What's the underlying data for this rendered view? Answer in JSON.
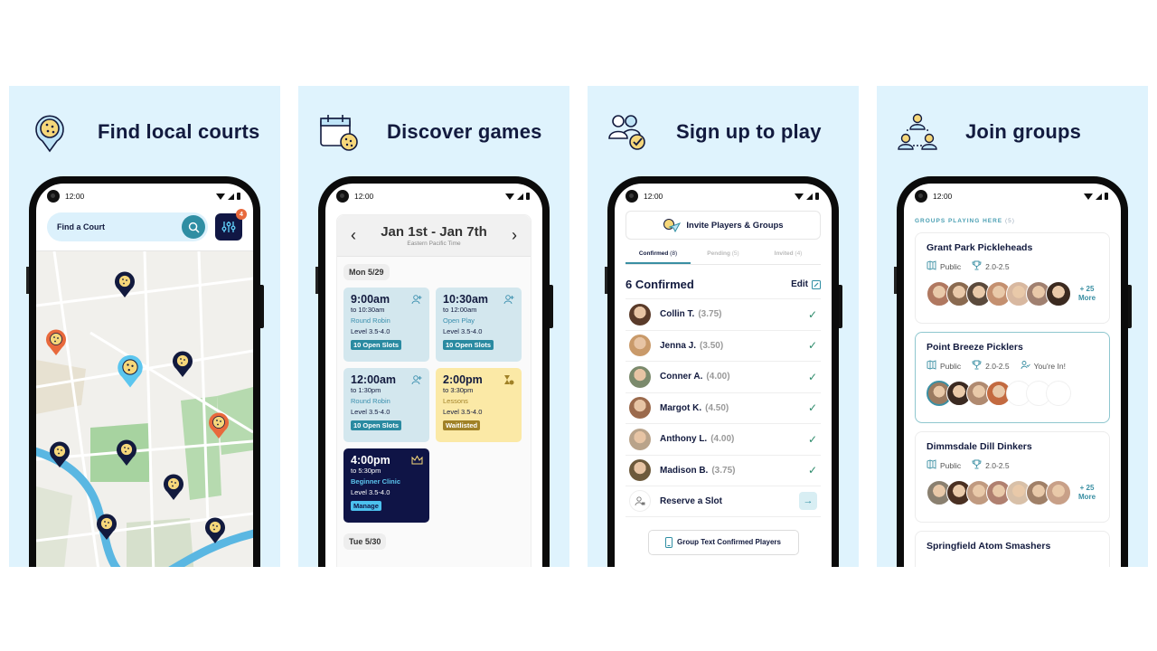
{
  "status_time": "12:00",
  "panels": [
    {
      "headline": "Find local courts",
      "icon": "court-pin-icon",
      "search": {
        "placeholder": "Find a Court",
        "filter_badge": "4"
      },
      "map": {
        "pins": [
          {
            "type": "navy"
          },
          {
            "type": "orange"
          },
          {
            "type": "selected"
          },
          {
            "type": "navy"
          },
          {
            "type": "orange"
          },
          {
            "type": "navy"
          },
          {
            "type": "navy"
          },
          {
            "type": "navy"
          },
          {
            "type": "navy"
          },
          {
            "type": "navy"
          }
        ]
      }
    },
    {
      "headline": "Discover games",
      "icon": "calendar-ball-icon",
      "calendar": {
        "range": "Jan 1st - Jan 7th",
        "timezone": "Eastern Pacific Time",
        "days": [
          {
            "label": "Mon 5/29",
            "games": [
              {
                "time": "9:00am",
                "end": "to 10:30am",
                "type": "Round Robin",
                "level": "Level 3.5-4.0",
                "tag": "10 Open Slots",
                "style": "blue",
                "icon": "add-user-icon"
              },
              {
                "time": "10:30am",
                "end": "to 12:00am",
                "type": "Open Play",
                "level": "Level 3.5-4.0",
                "tag": "10 Open Slots",
                "style": "blue",
                "icon": "add-user-icon"
              },
              {
                "time": "12:00am",
                "end": "to 1:30pm",
                "type": "Round Robin",
                "level": "Level 3.5-4.0",
                "tag": "10 Open Slots",
                "style": "blue",
                "icon": "add-user-icon"
              },
              {
                "time": "2:00pm",
                "end": "to 3:30pm",
                "type": "Lessons",
                "level": "Level 3.5-4.0",
                "tag": "Waitlisted",
                "style": "yellow",
                "icon": "hourglass-user-icon"
              },
              {
                "time": "4:00pm",
                "end": "to 5:30pm",
                "type": "Beginner Clinic",
                "level": "Level 3.5-4.0",
                "tag": "Manage",
                "style": "navy",
                "icon": "crown-icon"
              }
            ]
          },
          {
            "label": "Tue 5/30",
            "games": []
          }
        ]
      }
    },
    {
      "headline": "Sign up to play",
      "icon": "players-check-icon",
      "invite_label": "Invite Players & Groups",
      "tabs": [
        {
          "label": "Confirmed",
          "count": "(8)",
          "active": true
        },
        {
          "label": "Pending",
          "count": "(5)",
          "active": false
        },
        {
          "label": "Invited",
          "count": "(4)",
          "active": false
        }
      ],
      "confirmed_title": "6 Confirmed",
      "edit_label": "Edit",
      "players": [
        {
          "name": "Collin T.",
          "rating": "(3.75)",
          "avatar_color": "#5a3b2a"
        },
        {
          "name": "Jenna J.",
          "rating": "(3.50)",
          "avatar_color": "#c99a6a"
        },
        {
          "name": "Conner A.",
          "rating": "(4.00)",
          "avatar_color": "#7b8a6c"
        },
        {
          "name": "Margot K.",
          "rating": "(4.50)",
          "avatar_color": "#9b6a4c"
        },
        {
          "name": "Anthony L.",
          "rating": "(4.00)",
          "avatar_color": "#b9a38a"
        },
        {
          "name": "Madison B.",
          "rating": "(3.75)",
          "avatar_color": "#6d5a3c"
        }
      ],
      "reserve_label": "Reserve a Slot",
      "group_text_label": "Group Text Confirmed Players"
    },
    {
      "headline": "Join groups",
      "icon": "group-network-icon",
      "groups_label": "GROUPS PLAYING HERE",
      "groups_count": "(5)",
      "groups": [
        {
          "name": "Grant Park Pickleheads",
          "visibility": "Public",
          "level": "2.0-2.5",
          "status": "",
          "more": "+ 25\nMore",
          "more_top": "+ 25",
          "more_bottom": "More",
          "selected": false,
          "avatars": [
            "#b07860",
            "#8a6a50",
            "#5b4a3c",
            "#c49070",
            "#d8b8a0",
            "#a08070",
            "#3b2a20"
          ]
        },
        {
          "name": "Point Breeze Picklers",
          "visibility": "Public",
          "level": "2.0-2.5",
          "status": "You're In!",
          "more_top": "",
          "more_bottom": "",
          "selected": true,
          "avatars": [
            "#9b7a60",
            "#3b2a22",
            "#b08a70",
            "#c36a40"
          ],
          "empty_slots": 3
        },
        {
          "name": "Dimmsdale Dill Dinkers",
          "visibility": "Public",
          "level": "2.0-2.5",
          "status": "",
          "more_top": "+ 25",
          "more_bottom": "More",
          "selected": false,
          "avatars": [
            "#8a8070",
            "#4a3022",
            "#c09a80",
            "#b08070",
            "#d8c0a8",
            "#a08068",
            "#c8a088"
          ]
        },
        {
          "name": "Springfield Atom Smashers",
          "visibility": "",
          "level": "",
          "status": "",
          "more_top": "",
          "more_bottom": "",
          "selected": false,
          "avatars": []
        }
      ]
    }
  ],
  "colors": {
    "panel_bg": "#dff3fd",
    "navy": "#121a3e",
    "teal": "#2f8ea3",
    "orange": "#e8693c",
    "yellow_card": "#fbe9a6",
    "blue_card": "#d3e7ee"
  }
}
